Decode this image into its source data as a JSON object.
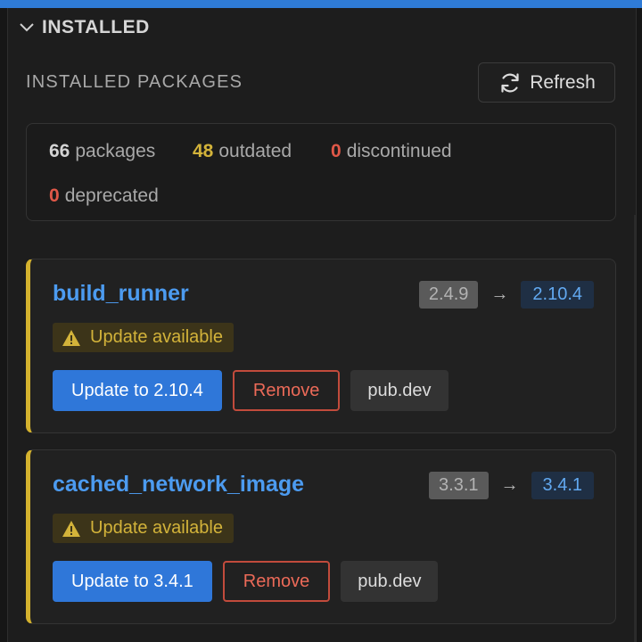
{
  "section": {
    "title": "INSTALLED"
  },
  "subheader": {
    "title": "INSTALLED PACKAGES",
    "refresh_label": "Refresh"
  },
  "stats": {
    "packages_count": "66",
    "packages_label": "packages",
    "outdated_count": "48",
    "outdated_label": "outdated",
    "discontinued_count": "0",
    "discontinued_label": "discontinued",
    "deprecated_count": "0",
    "deprecated_label": "deprecated"
  },
  "packages": [
    {
      "name": "build_runner",
      "current_version": "2.4.9",
      "latest_version": "2.10.4",
      "status": "Update available",
      "update_label": "Update to 2.10.4",
      "remove_label": "Remove",
      "pubdev_label": "pub.dev"
    },
    {
      "name": "cached_network_image",
      "current_version": "3.3.1",
      "latest_version": "3.4.1",
      "status": "Update available",
      "update_label": "Update to 3.4.1",
      "remove_label": "Remove",
      "pubdev_label": "pub.dev"
    }
  ],
  "colors": {
    "accent": "#2f77d9",
    "outdated": "#d3b33a",
    "danger": "#e05848",
    "link": "#4c9bf0"
  }
}
